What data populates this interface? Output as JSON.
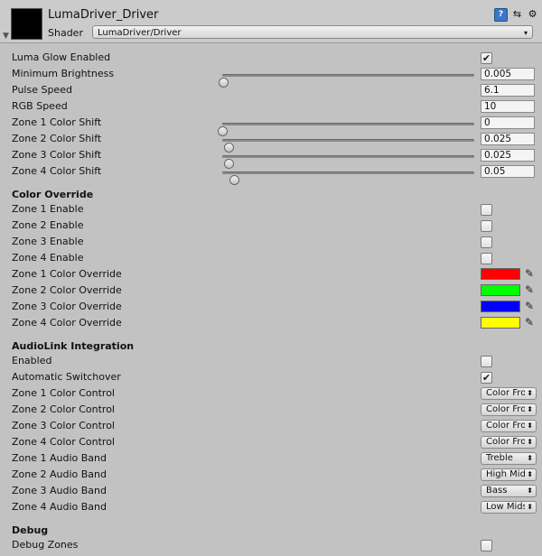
{
  "material": {
    "title": "LumaDriver_Driver",
    "shader_label": "Shader",
    "shader_value": "LumaDriver/Driver"
  },
  "props": {
    "glow_enabled": "Luma Glow Enabled",
    "min_brightness": "Minimum Brightness",
    "min_brightness_val": "0.005",
    "pulse_speed": "Pulse Speed",
    "pulse_speed_val": "6.1",
    "rgb_speed": "RGB Speed",
    "rgb_speed_val": "10",
    "zone1_shift": "Zone 1 Color Shift",
    "zone1_shift_val": "0",
    "zone2_shift": "Zone 2 Color Shift",
    "zone2_shift_val": "0.025",
    "zone3_shift": "Zone 3 Color Shift",
    "zone3_shift_val": "0.025",
    "zone4_shift": "Zone 4 Color Shift",
    "zone4_shift_val": "0.05"
  },
  "color_override": {
    "title": "Color Override",
    "zone1_enable": "Zone 1 Enable",
    "zone2_enable": "Zone 2 Enable",
    "zone3_enable": "Zone 3 Enable",
    "zone4_enable": "Zone 4 Enable",
    "zone1_override": "Zone 1 Color Override",
    "zone2_override": "Zone 2 Color Override",
    "zone3_override": "Zone 3 Color Override",
    "zone4_override": "Zone 4 Color Override",
    "colors": [
      "#ff0000",
      "#00ff00",
      "#0000ff",
      "#ffff00"
    ]
  },
  "audiolink": {
    "title": "AudioLink Integration",
    "enabled": "Enabled",
    "auto_switch": "Automatic Switchover",
    "zone1_control": "Zone 1 Color Control",
    "zone2_control": "Zone 2 Color Control",
    "zone3_control": "Zone 3 Color Control",
    "zone4_control": "Zone 4 Color Control",
    "control_value": "Color Fro",
    "zone1_band": "Zone 1 Audio Band",
    "zone2_band": "Zone 2 Audio Band",
    "zone3_band": "Zone 3 Audio Band",
    "zone4_band": "Zone 4 Audio Band",
    "zone1_band_val": "Treble",
    "zone2_band_val": "High Mid:",
    "zone3_band_val": "Bass",
    "zone4_band_val": "Low Mids"
  },
  "debug": {
    "title": "Debug",
    "debug_zones": "Debug Zones"
  },
  "state": {
    "glow_enabled": true,
    "zone_enables": [
      false,
      false,
      false,
      false
    ],
    "audiolink_enabled": false,
    "auto_switch": true,
    "debug_zones": false,
    "slider_fractions": {
      "min_brightness": 0.005,
      "zone1": 0,
      "zone2": 0.025,
      "zone3": 0.025,
      "zone4": 0.05
    }
  },
  "icons": {
    "help": "help-icon",
    "preset": "preset-icon",
    "gear": "gear-icon",
    "eyedropper": "eyedropper-icon",
    "check": "checkmark-icon"
  }
}
